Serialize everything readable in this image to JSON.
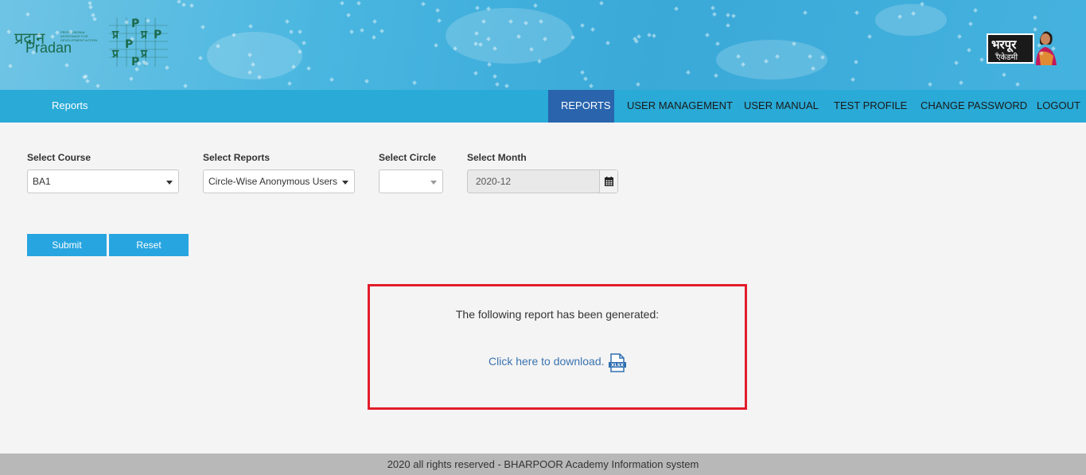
{
  "header": {
    "pradan_hindi": "प्रदान",
    "pradan_english": "Pradan",
    "pradan_tagline": "PROFESSIONAL ASSISTANCE FOR DEVELOPMENT ACTION",
    "bharpoor_title": "भरपूर",
    "bharpoor_subtitle": "एकेडमी"
  },
  "nav": {
    "brand": "Reports",
    "items": [
      {
        "label": "REPORTS",
        "active": true
      },
      {
        "label": "USER MANAGEMENT",
        "active": false
      },
      {
        "label": "USER MANUAL",
        "active": false
      },
      {
        "label": "TEST PROFILE",
        "active": false
      },
      {
        "label": "CHANGE PASSWORD",
        "active": false
      },
      {
        "label": "LOGOUT",
        "active": false
      }
    ]
  },
  "form": {
    "course": {
      "label": "Select Course",
      "value": "BA1"
    },
    "report": {
      "label": "Select Reports",
      "value": "Circle-Wise Anonymous Users"
    },
    "circle": {
      "label": "Select Circle",
      "value": ""
    },
    "month": {
      "label": "Select Month",
      "value": "2020-12"
    },
    "submit_label": "Submit",
    "reset_label": "Reset"
  },
  "result": {
    "message": "The following report has been generated:",
    "download_label": "Click here to download.",
    "file_icon_text": "XLSX"
  },
  "footer": {
    "text": "2020 all rights reserved - BHARPOOR Academy Information system"
  },
  "colors": {
    "navbar": "#29aad7",
    "nav_active": "#2964ad",
    "button": "#27a5e0",
    "highlight_border": "#e21d2a",
    "link": "#3b73b0"
  }
}
